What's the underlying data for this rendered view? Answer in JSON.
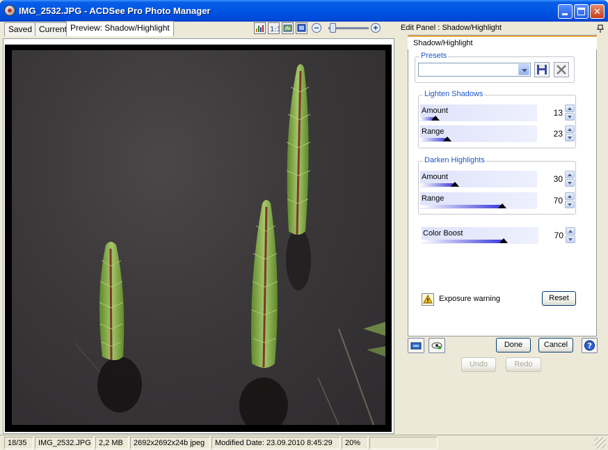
{
  "window": {
    "title": "IMG_2532.JPG - ACDSee Pro Photo Manager",
    "minimize_label": "_",
    "maximize_label": "□",
    "close_label": "✕"
  },
  "tabs": [
    {
      "label": "Saved"
    },
    {
      "label": "Current"
    },
    {
      "label": "Preview: Shadow/Highlight",
      "active": true
    }
  ],
  "toolbar": {
    "zoom_minus": "−",
    "zoom_plus": "+",
    "zoom_slider_level": 0.1
  },
  "panel": {
    "header": "Edit Panel : Shadow/Highlight",
    "tab_label": "Shadow/Highlight",
    "presets": {
      "title": "Presets",
      "selected": ""
    },
    "lighten_shadows": {
      "title": "Lighten Shadows",
      "amount": {
        "label": "Amount",
        "value": "13",
        "level": 0.13
      },
      "range": {
        "label": "Range",
        "value": "23",
        "level": 0.23
      }
    },
    "darken_highlights": {
      "title": "Darken Highlights",
      "amount": {
        "label": "Amount",
        "value": "30",
        "level": 0.3
      },
      "range": {
        "label": "Range",
        "value": "70",
        "level": 0.7
      }
    },
    "color_boost": {
      "label": "Color Boost",
      "value": "70",
      "level": 0.7
    },
    "exposure_warning": "Exposure warning",
    "reset_label": "Reset",
    "done_label": "Done",
    "cancel_label": "Cancel",
    "help_label": "?",
    "undo_label": "Undo",
    "redo_label": "Redo"
  },
  "status": {
    "position": "18/35",
    "filename": "IMG_2532.JPG",
    "size": "2,2 MB",
    "dimensions": "2692x2692x24b jpeg",
    "modified": "Modified Date: 23.09.2010 8:45:29",
    "zoom": "20%"
  },
  "colors": {
    "titlebar": "#0055e5",
    "accent": "#1c55cc",
    "panel_tab_highlight": "#f4a53d"
  }
}
